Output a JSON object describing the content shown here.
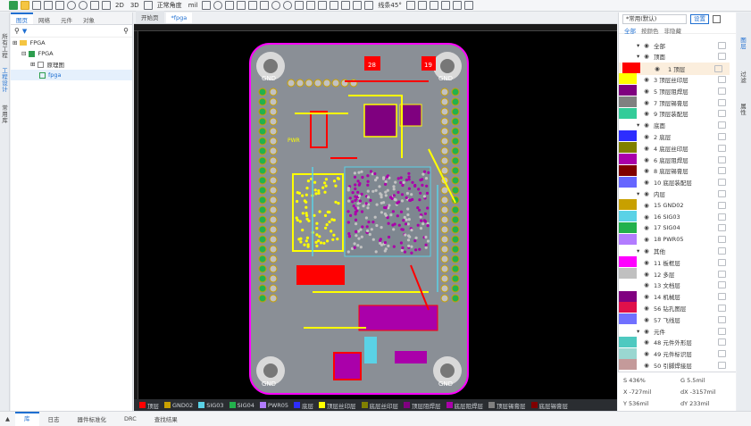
{
  "toolbar": {
    "view2d": "2D",
    "view3d": "3D",
    "angle": "正常角度",
    "unit": "mil",
    "routing_angle": "线条45°"
  },
  "left_strip": [
    "所有工程",
    "工程设计",
    "常用库"
  ],
  "left_panel": {
    "tabs": [
      "图页",
      "网络",
      "元件",
      "对象"
    ],
    "tree": [
      {
        "label": "FPGA",
        "level": 0
      },
      {
        "label": "FPGA",
        "level": 1
      },
      {
        "label": "原理图",
        "level": 2
      },
      {
        "label": "fpga",
        "level": 2
      }
    ]
  },
  "doc_tabs": [
    "开始页",
    "*fpga"
  ],
  "layer_bar": [
    {
      "label": "顶层",
      "color": "#ff0000"
    },
    {
      "label": "GND02",
      "color": "#c8a000"
    },
    {
      "label": "SIG03",
      "color": "#5ad2e6"
    },
    {
      "label": "SIG04",
      "color": "#22b14c"
    },
    {
      "label": "PWR05",
      "color": "#b27cff"
    },
    {
      "label": "底层",
      "color": "#2d2dff"
    },
    {
      "label": "顶层丝印层",
      "color": "#ffff00"
    },
    {
      "label": "底层丝印层",
      "color": "#808000"
    },
    {
      "label": "顶层阻焊层",
      "color": "#7f007f"
    },
    {
      "label": "底层阻焊层",
      "color": "#aa00aa"
    },
    {
      "label": "顶层锡膏层",
      "color": "#808080"
    },
    {
      "label": "底层锡膏层",
      "color": "#800000"
    }
  ],
  "right_panel": {
    "preset": "*常用(默认)",
    "apply": "设置",
    "filter_tabs": [
      "全部",
      "按颜色",
      "非隐藏"
    ],
    "layers": [
      {
        "name": "全部",
        "group": true,
        "color": ""
      },
      {
        "name": "顶面",
        "group": true,
        "color": ""
      },
      {
        "name": "1 顶层",
        "color": "#ff0000",
        "selected": true
      },
      {
        "name": "3 顶层丝印层",
        "color": "#ffff00"
      },
      {
        "name": "5 顶层阻焊层",
        "color": "#7f007f"
      },
      {
        "name": "7 顶层锡膏层",
        "color": "#808080"
      },
      {
        "name": "9 顶层装配层",
        "color": "#33cc99"
      },
      {
        "name": "底面",
        "group": true,
        "color": ""
      },
      {
        "name": "2 底层",
        "color": "#2d2dff"
      },
      {
        "name": "4 底层丝印层",
        "color": "#808000"
      },
      {
        "name": "6 底层阻焊层",
        "color": "#aa00aa"
      },
      {
        "name": "8 底层锡膏层",
        "color": "#800000"
      },
      {
        "name": "10 底层装配层",
        "color": "#6666ff"
      },
      {
        "name": "内层",
        "group": true,
        "color": ""
      },
      {
        "name": "15 GND02",
        "color": "#c8a000"
      },
      {
        "name": "16 SIG03",
        "color": "#5ad2e6"
      },
      {
        "name": "17 SIG04",
        "color": "#22b14c"
      },
      {
        "name": "18 PWR05",
        "color": "#b27cff"
      },
      {
        "name": "其他",
        "group": true,
        "color": ""
      },
      {
        "name": "11 板框层",
        "color": "#ff00ff"
      },
      {
        "name": "12 多层",
        "color": "#c0c0c0"
      },
      {
        "name": "13 文档层",
        "color": "#ffffff"
      },
      {
        "name": "14 机械层",
        "color": "#800080"
      },
      {
        "name": "56 钻孔图层",
        "color": "#e0104a"
      },
      {
        "name": "57 飞线层",
        "color": "#7070ff"
      },
      {
        "name": "元件",
        "group": true,
        "color": ""
      },
      {
        "name": "48 元件外形层",
        "color": "#4ec9c0"
      },
      {
        "name": "49 元件标识层",
        "color": "#9ad7d1"
      },
      {
        "name": "50 引脚焊接层",
        "color": "#c49a9a"
      }
    ]
  },
  "right_strip": [
    "图层",
    "过滤",
    "属性"
  ],
  "coords": {
    "s": "S  436%",
    "g": "G  5.5mil",
    "x": "X  -727mil",
    "dx": "dX  -3157mil",
    "y": "Y  536mil",
    "dy": "dY  233mil"
  },
  "bottom_tabs": [
    "库",
    "日志",
    "器件标准化",
    "DRC",
    "查找结果"
  ],
  "board_labels": {
    "gnd": "GND",
    "pwr": "PWR",
    "num28": "28",
    "num19": "19"
  },
  "colors": {
    "accent": "#1f6fd1",
    "board": "#8a8f96",
    "outline": "#ff00ff",
    "silk": "#ffff00",
    "top": "#ff0000",
    "pad": "#c2c2c2",
    "via": "#8aa0b0"
  }
}
